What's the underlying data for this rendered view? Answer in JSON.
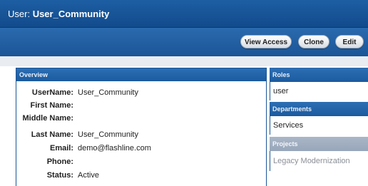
{
  "header": {
    "prefix": "User:",
    "name": "User_Community"
  },
  "toolbar": {
    "view_access": "View Access",
    "clone": "Clone",
    "edit": "Edit"
  },
  "overview": {
    "title": "Overview",
    "fields": [
      {
        "label": "UserName:",
        "value": "User_Community"
      },
      {
        "label": "First Name:",
        "value": ""
      },
      {
        "label": "Middle Name:",
        "value": ""
      },
      {
        "label": "Last Name:",
        "value": "User_Community"
      },
      {
        "label": "Email:",
        "value": "demo@flashline.com"
      },
      {
        "label": "Phone:",
        "value": ""
      },
      {
        "label": "Status:",
        "value": "Active"
      }
    ]
  },
  "roles": {
    "title": "Roles",
    "value": "user"
  },
  "departments": {
    "title": "Departments",
    "value": "Services"
  },
  "projects": {
    "title": "Projects",
    "value": "Legacy Modernization"
  }
}
